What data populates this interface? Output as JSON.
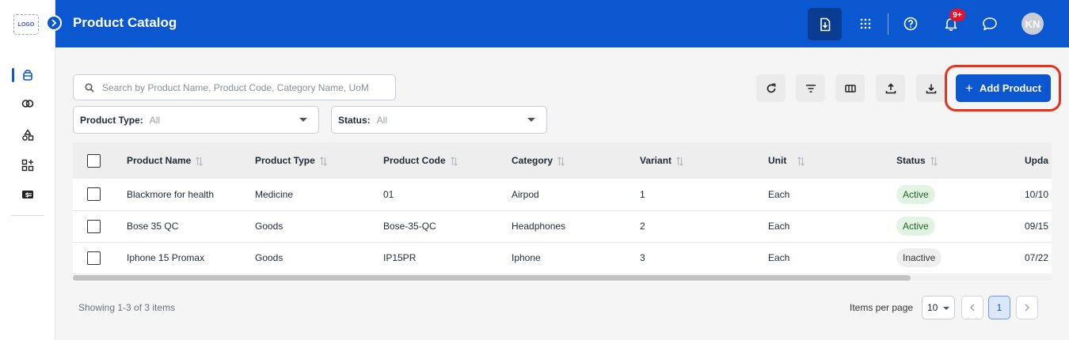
{
  "sidebar": {
    "logo_text": "LOGO",
    "items": [
      {
        "icon": "product-box-icon",
        "active": true
      },
      {
        "icon": "overlap-circles-icon",
        "active": false
      },
      {
        "icon": "shapes-icon",
        "active": false
      },
      {
        "icon": "grid-add-icon",
        "active": false
      },
      {
        "icon": "price-tag-icon",
        "active": false
      }
    ]
  },
  "header": {
    "title": "Product Catalog",
    "notification_badge": "9+",
    "avatar_initials": "KN",
    "icons": [
      "download-file-icon",
      "apps-grid-icon",
      "help-icon",
      "bell-icon",
      "chat-icon"
    ]
  },
  "toolbar": {
    "search_placeholder": "Search by Product Name, Product Code, Category Name, UoM",
    "filters": [
      {
        "label": "Product Type:",
        "value": "All"
      },
      {
        "label": "Status:",
        "value": "All"
      }
    ],
    "buttons": [
      "refresh-icon",
      "filter-icon",
      "columns-icon",
      "upload-icon",
      "download-icon"
    ],
    "add_label": "Add Product"
  },
  "table": {
    "columns": [
      "Product Name",
      "Product Type",
      "Product Code",
      "Category",
      "Variant",
      "Unit",
      "Status",
      "Upda"
    ],
    "rows": [
      {
        "name": "Blackmore for health",
        "type": "Medicine",
        "code": "01",
        "category": "Airpod",
        "variant": "1",
        "unit": "Each",
        "status": "Active",
        "updated": "10/10"
      },
      {
        "name": "Bose 35 QC",
        "type": "Goods",
        "code": "Bose-35-QC",
        "category": "Headphones",
        "variant": "2",
        "unit": "Each",
        "status": "Active",
        "updated": "09/15"
      },
      {
        "name": "Iphone 15 Promax",
        "type": "Goods",
        "code": "IP15PR",
        "category": "Iphone",
        "variant": "3",
        "unit": "Each",
        "status": "Inactive",
        "updated": "07/22"
      }
    ]
  },
  "footer": {
    "showing": "Showing 1-3 of 3 items",
    "items_per_page_label": "Items per page",
    "items_per_page": "10",
    "current_page": "1"
  },
  "colors": {
    "brand": "#0b57d0",
    "highlight": "#e8321d",
    "active_bg": "#e2f5e3",
    "inactive_bg": "#efefef"
  }
}
